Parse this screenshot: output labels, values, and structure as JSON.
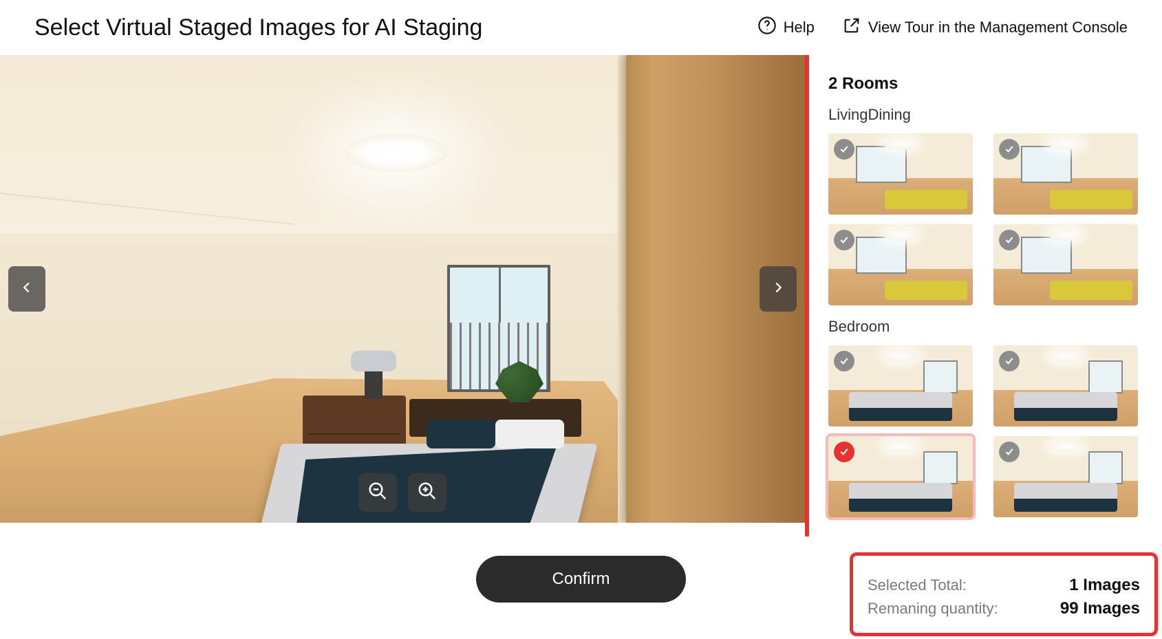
{
  "header": {
    "title": "Select Virtual Staged Images for AI Staging",
    "help_label": "Help",
    "view_tour_label": "View Tour in the Management Console"
  },
  "viewer": {
    "prev_label": "Previous image",
    "next_label": "Next image",
    "zoom_out_label": "Zoom out",
    "zoom_in_label": "Zoom in"
  },
  "sidebar": {
    "rooms_count_label": "2 Rooms",
    "rooms": [
      {
        "name": "LivingDining",
        "thumbs": [
          {
            "selected": false
          },
          {
            "selected": false
          },
          {
            "selected": false
          },
          {
            "selected": false
          }
        ]
      },
      {
        "name": "Bedroom",
        "thumbs": [
          {
            "selected": false
          },
          {
            "selected": false
          },
          {
            "selected": true
          },
          {
            "selected": false
          }
        ]
      }
    ]
  },
  "confirm_label": "Confirm",
  "summary": {
    "selected_label": "Selected Total:",
    "selected_value": "1 Images",
    "remaining_label": "Remaning quantity:",
    "remaining_value": "99 Images"
  }
}
